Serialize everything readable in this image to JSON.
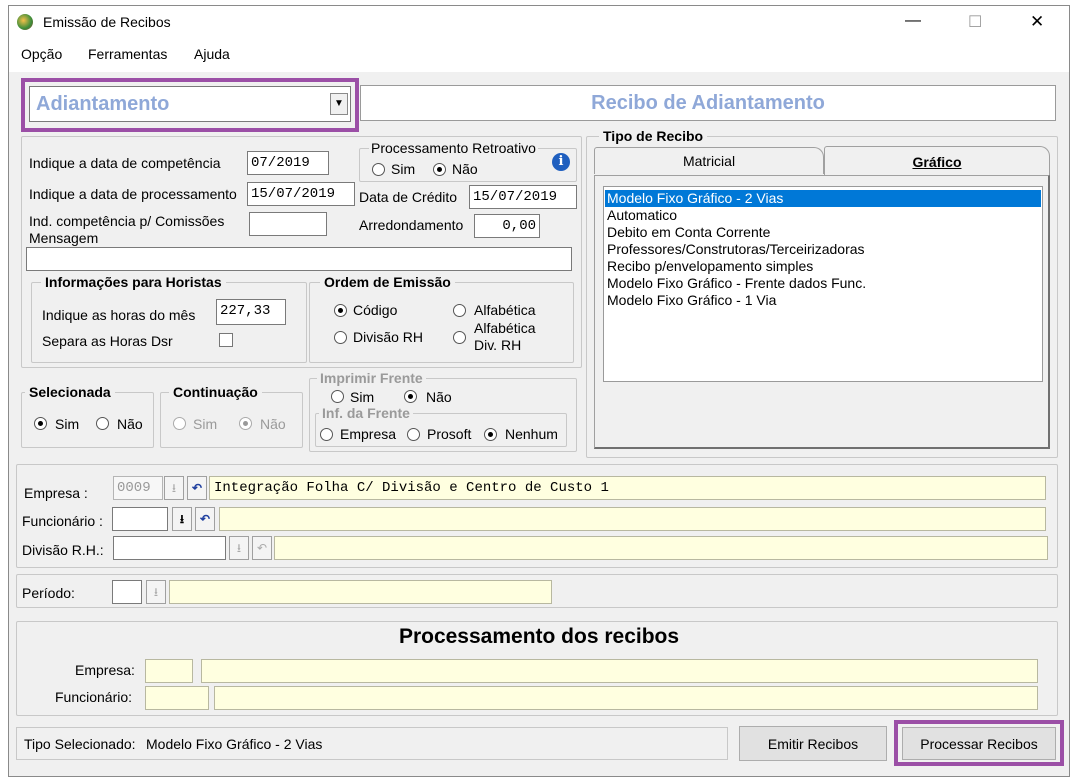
{
  "window": {
    "title": "Emissão de Recibos",
    "minimize": "—",
    "maximize": "☐",
    "close": "✕"
  },
  "menu": {
    "items": [
      "Opção",
      "Ferramentas",
      "Ajuda"
    ]
  },
  "recibo_type_select": {
    "value": "Adiantamento",
    "heading": "Recibo de Adiantamento"
  },
  "dates": {
    "competencia_label": "Indique a data de competência",
    "competencia_value": "07/2019",
    "processamento_label": "Indique a data de processamento",
    "processamento_value": "15/07/2019",
    "comissoes_label": "Ind. competência p/ Comissões",
    "comissoes_value": "",
    "mensagem_label": "Mensagem",
    "mensagem_value": ""
  },
  "retroativo": {
    "title": "Processamento Retroativo",
    "sim": "Sim",
    "nao": "Não",
    "info": "i"
  },
  "credito": {
    "label": "Data de Crédito",
    "value": "15/07/2019"
  },
  "arredondamento": {
    "label": "Arredondamento",
    "value": "0,00"
  },
  "horistas": {
    "title": "Informações para Horistas",
    "horas_label": "Indique as horas do mês",
    "horas_value": "227,33",
    "dsr_label": "Separa as Horas Dsr"
  },
  "ordem": {
    "title": "Ordem de Emissão",
    "codigo": "Código",
    "alfabetica": "Alfabética",
    "divisao": "Divisão RH",
    "alfabetica_div": "Alfabética Div. RH"
  },
  "selecionada": {
    "title": "Selecionada",
    "sim": "Sim",
    "nao": "Não"
  },
  "continuacao": {
    "title": "Continuação",
    "sim": "Sim",
    "nao": "Não"
  },
  "imprimir_frente": {
    "title": "Imprimir Frente",
    "sim": "Sim",
    "nao": "Não"
  },
  "inf_frente": {
    "title": "Inf. da Frente",
    "empresa": "Empresa",
    "prosoft": "Prosoft",
    "nenhum": "Nenhum"
  },
  "tipo_recibo": {
    "title": "Tipo de Recibo",
    "tabs": [
      "Matricial",
      "Gráfico"
    ],
    "items": [
      "Modelo Fixo Gráfico - 2 Vias",
      "Automatico",
      "Debito em Conta Corrente",
      "Professores/Construtoras/Terceirizadoras",
      "Recibo p/envelopamento simples",
      "Modelo Fixo Gráfico - Frente dados Func.",
      "Modelo Fixo Gráfico - 1 Via"
    ]
  },
  "filtros": {
    "empresa_label": "Empresa :",
    "empresa_code": "0009",
    "empresa_name": "Integração Folha C/ Divisão e Centro de Custo 1",
    "funcionario_label": "Funcionário :",
    "divisao_label": "Divisão R.H.:"
  },
  "periodo": {
    "label": "Período:"
  },
  "processamento": {
    "title": "Processamento dos recibos",
    "empresa_label": "Empresa:",
    "funcionario_label": "Funcionário:"
  },
  "status": {
    "label": "Tipo Selecionado:",
    "value": "Modelo Fixo Gráfico - 2 Vias"
  },
  "buttons": {
    "emitir": "Emitir Recibos",
    "processar": "Processar Recibos"
  }
}
